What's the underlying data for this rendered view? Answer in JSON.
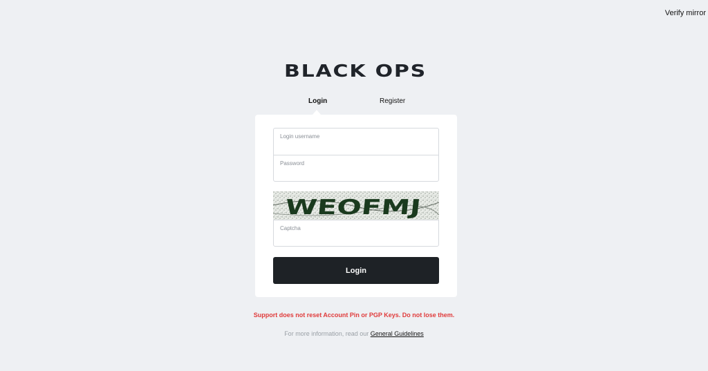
{
  "header": {
    "verify_mirror_label": "Verify mirror"
  },
  "logo": {
    "text": "BLACK OPS"
  },
  "tabs": [
    {
      "label": "Login",
      "active": true
    },
    {
      "label": "Register",
      "active": false
    }
  ],
  "form": {
    "username": {
      "label": "Login username",
      "value": ""
    },
    "password": {
      "label": "Password",
      "value": ""
    },
    "captcha": {
      "image_text": "WEOFMJ",
      "label": "Captcha",
      "value": ""
    },
    "submit_label": "Login"
  },
  "footer": {
    "warning": "Support does not reset Account Pin or PGP Keys. Do not lose them.",
    "info_prefix": "For more information, read our",
    "guidelines_link": "General Guidelines"
  },
  "colors": {
    "background": "#eef0f3",
    "card": "#ffffff",
    "button": "#1e2226",
    "warning": "#e03b3b"
  }
}
